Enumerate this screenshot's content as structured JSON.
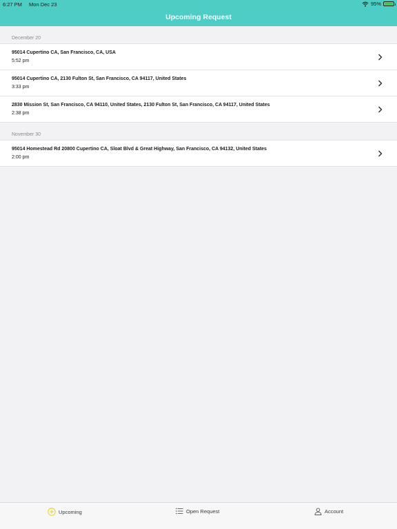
{
  "status": {
    "time": "6:27 PM",
    "date": "Mon Dec 23",
    "battery": "95%"
  },
  "header": {
    "title": "Upcoming Request"
  },
  "sections": [
    {
      "header": "December 20",
      "rows": [
        {
          "address": "95014  Cupertino CA, San Francisco, CA, USA",
          "time": "5:52 pm"
        },
        {
          "address": "95014  Cupertino CA, 2130 Fulton St, San Francisco, CA 94117, United States",
          "time": "3:33 pm"
        },
        {
          "address": "2830 Mission St, San Francisco, CA 94110, United States, 2130 Fulton St, San Francisco, CA 94117, United States",
          "time": "2:38 pm"
        }
      ]
    },
    {
      "header": "November 30",
      "rows": [
        {
          "address": "95014 Homestead Rd 20800 Cupertino CA, Sloat Blvd & Great Highway, San Francisco, CA 94132, United States",
          "time": "2:00 pm"
        }
      ]
    }
  ],
  "tabs": [
    {
      "label": "Upcoming",
      "icon": "plus-circle-icon",
      "active": true
    },
    {
      "label": "Open Request",
      "icon": "list-icon",
      "active": false
    },
    {
      "label": "Account",
      "icon": "person-icon",
      "active": false
    }
  ],
  "colors": {
    "accent": "#4ecdc4",
    "tab_active_icon": "#e6d21c",
    "battery": "#3cc84a"
  }
}
